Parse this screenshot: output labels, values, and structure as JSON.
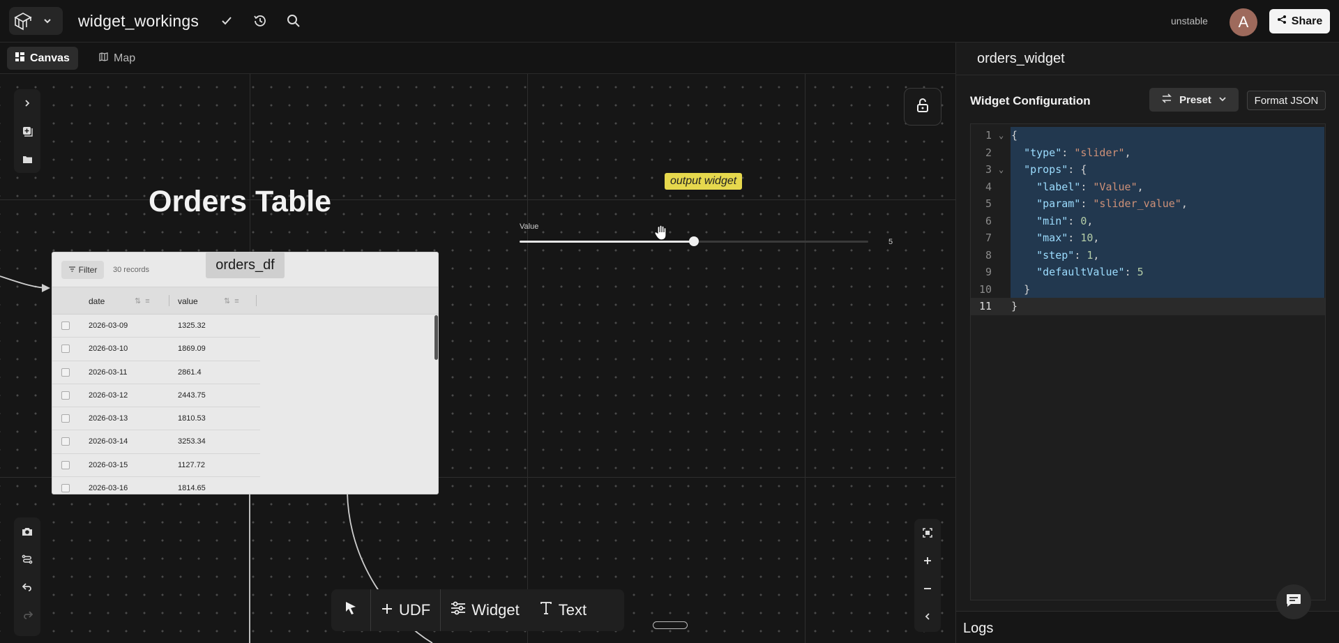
{
  "header": {
    "project_title": "widget_workings",
    "branch": "unstable",
    "avatar_letter": "A",
    "share_label": "Share"
  },
  "tabs": [
    {
      "label": "Canvas",
      "icon": "grid-icon",
      "active": true
    },
    {
      "label": "Map",
      "icon": "map-icon",
      "active": false
    }
  ],
  "canvas": {
    "section_title": "Orders Table",
    "output_label": "output widget",
    "slider": {
      "label": "Value",
      "min": 0,
      "max": 10,
      "value": 5,
      "value_text": "5"
    },
    "dataframe": {
      "name": "orders_df",
      "filter_label": "Filter",
      "records_text": "30 records",
      "columns": [
        "date",
        "value"
      ],
      "rows": [
        [
          "2026-03-09",
          "1325.32"
        ],
        [
          "2026-03-10",
          "1869.09"
        ],
        [
          "2026-03-11",
          "2861.4"
        ],
        [
          "2026-03-12",
          "2443.75"
        ],
        [
          "2026-03-13",
          "1810.53"
        ],
        [
          "2026-03-14",
          "3253.34"
        ],
        [
          "2026-03-15",
          "1127.72"
        ],
        [
          "2026-03-16",
          "1814.65"
        ]
      ]
    }
  },
  "bottom_toolbar": {
    "udf_label": "UDF",
    "widget_label": "Widget",
    "text_label": "Text"
  },
  "right_panel": {
    "title": "orders_widget",
    "section_title": "Widget Configuration",
    "preset_label": "Preset",
    "format_label": "Format JSON",
    "logs_label": "Logs",
    "code_lines": [
      "{",
      "  \"type\": \"slider\",",
      "  \"props\": {",
      "    \"label\": \"Value\",",
      "    \"param\": \"slider_value\",",
      "    \"min\": 0,",
      "    \"max\": 10,",
      "    \"step\": 1,",
      "    \"defaultValue\": 5",
      "  }",
      "}"
    ]
  },
  "colors": {
    "background": "#121212",
    "output_label": "#e6d84d",
    "selection": "#264f78"
  }
}
